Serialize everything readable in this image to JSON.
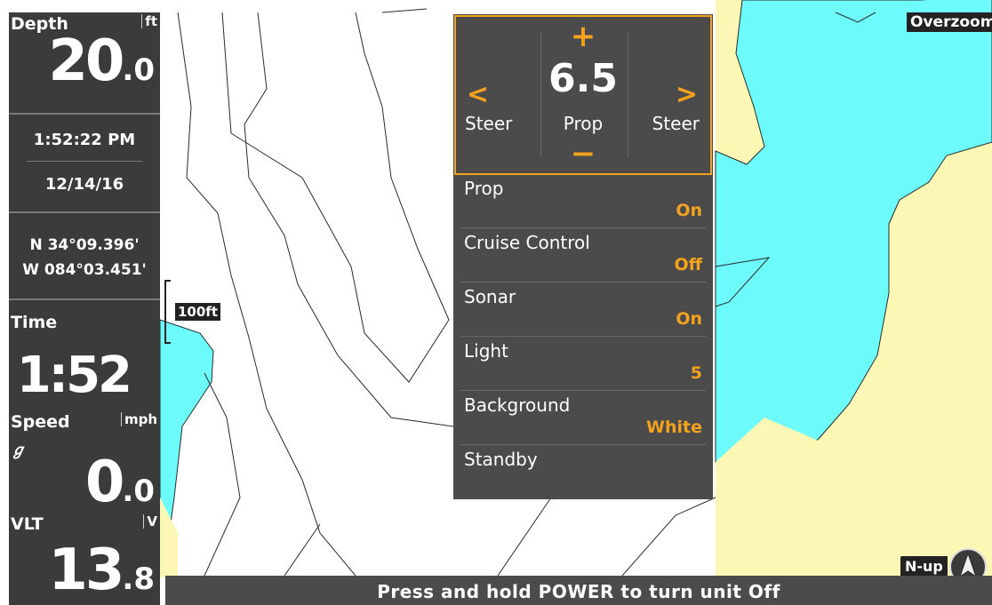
{
  "sidebar": {
    "depth": {
      "label": "Depth",
      "unit": "ft",
      "value_int": "20",
      "value_dec": ".0"
    },
    "clock": "1:52:22 PM",
    "date": "12/14/16",
    "position": {
      "lat": "N 34°09.396'",
      "lon": "W 084°03.451'"
    },
    "time": {
      "label": "Time",
      "value": "1:52"
    },
    "speed": {
      "label": "Speed",
      "unit": "mph",
      "value_int": "0",
      "value_dec": ".0"
    },
    "voltage": {
      "label": "VLT",
      "unit": "V",
      "value_int": "13",
      "value_dec": ".8"
    }
  },
  "map": {
    "scale_label": "100ft",
    "zoom_label": "Overzoom",
    "orientation_label": "N-up",
    "colors": {
      "water": "#6cfafa",
      "land": "#fdf7b6",
      "contour": "#2a2a2a"
    }
  },
  "menu": {
    "prop_control": {
      "value": "6.5",
      "center_label": "Prop",
      "left_label": "Steer",
      "right_label": "Steer",
      "increase_symbol": "+",
      "decrease_symbol": "−",
      "left_arrow": "<",
      "right_arrow": ">"
    },
    "items": [
      {
        "label": "Prop",
        "value": "On"
      },
      {
        "label": "Cruise Control",
        "value": "Off"
      },
      {
        "label": "Sonar",
        "value": "On"
      },
      {
        "label": "Light",
        "value": "5"
      },
      {
        "label": "Background",
        "value": "White"
      },
      {
        "label": "Standby",
        "value": ""
      }
    ],
    "accent_color": "#f3a21d"
  },
  "status": {
    "message": "Press and hold POWER to turn unit Off"
  }
}
